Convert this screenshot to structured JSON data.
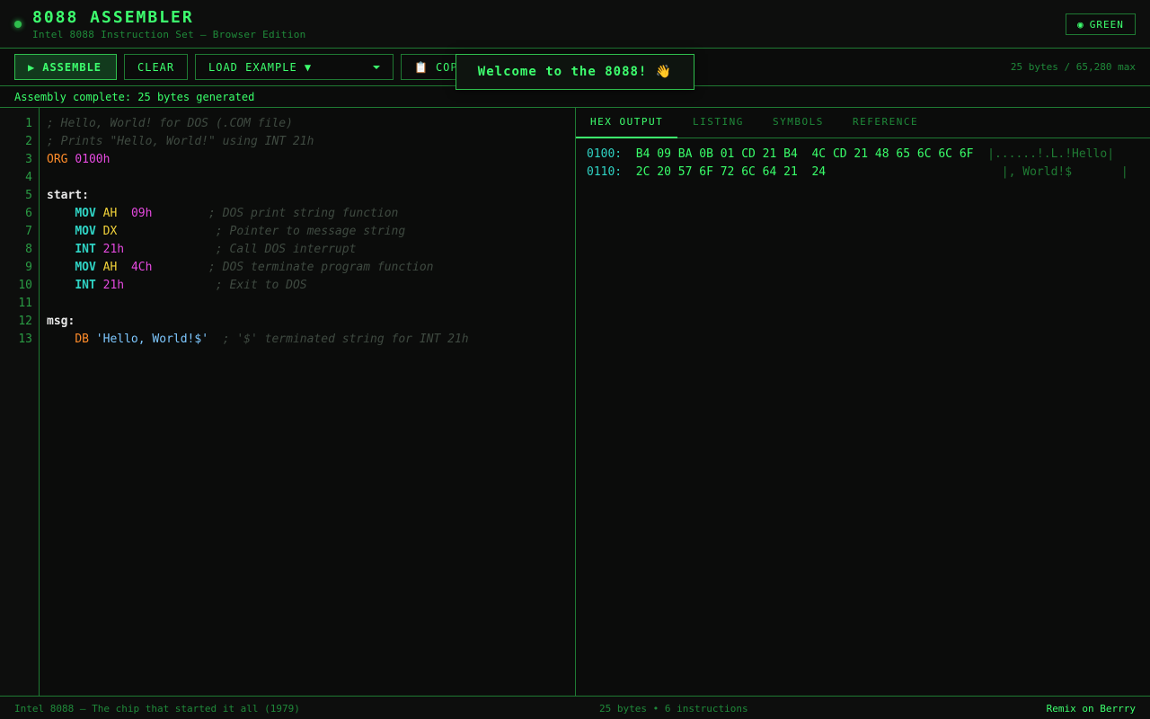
{
  "header": {
    "title": "8088 ASSEMBLER",
    "subtitle": "Intel 8088 Instruction Set — Browser Edition",
    "theme_icon": "◉",
    "theme_label": "GREEN"
  },
  "toolbar": {
    "assemble_icon": "▶",
    "assemble_label": "ASSEMBLE",
    "clear_label": "CLEAR",
    "load_example_label": "LOAD EXAMPLE ▼",
    "copy_icon": "📋",
    "copy_label": "COP",
    "bytes_info": "25 bytes / 65,280 max"
  },
  "status": {
    "message": "Assembly complete: 25 bytes generated"
  },
  "toast": {
    "message": "Welcome to the 8088! 👋"
  },
  "editor": {
    "line_numbers": [
      "1",
      "2",
      "3",
      "4",
      "5",
      "6",
      "7",
      "8",
      "9",
      "10",
      "11",
      "12",
      "13"
    ],
    "lines": [
      [
        {
          "t": "; Hello, World! for DOS (.COM file)",
          "c": "cmt"
        }
      ],
      [
        {
          "t": "; Prints \"Hello, World!\" using INT 21h",
          "c": "cmt"
        }
      ],
      [
        {
          "t": "ORG",
          "c": "dir"
        },
        {
          "t": " ",
          "c": ""
        },
        {
          "t": "0100h",
          "c": "num"
        }
      ],
      [],
      [
        {
          "t": "start:",
          "c": "lbl"
        }
      ],
      [
        {
          "t": "    ",
          "c": ""
        },
        {
          "t": "MOV",
          "c": "kw"
        },
        {
          "t": " ",
          "c": ""
        },
        {
          "t": "AH",
          "c": "reg"
        },
        {
          "t": "  ",
          "c": ""
        },
        {
          "t": "09h",
          "c": "num"
        },
        {
          "t": "        ",
          "c": ""
        },
        {
          "t": "; DOS print string function",
          "c": "cmt"
        }
      ],
      [
        {
          "t": "    ",
          "c": ""
        },
        {
          "t": "MOV",
          "c": "kw"
        },
        {
          "t": " ",
          "c": ""
        },
        {
          "t": "DX",
          "c": "reg"
        },
        {
          "t": "              ",
          "c": ""
        },
        {
          "t": "; Pointer to message string",
          "c": "cmt"
        }
      ],
      [
        {
          "t": "    ",
          "c": ""
        },
        {
          "t": "INT",
          "c": "kw"
        },
        {
          "t": " ",
          "c": ""
        },
        {
          "t": "21h",
          "c": "num"
        },
        {
          "t": "             ",
          "c": ""
        },
        {
          "t": "; Call DOS interrupt",
          "c": "cmt"
        }
      ],
      [
        {
          "t": "    ",
          "c": ""
        },
        {
          "t": "MOV",
          "c": "kw"
        },
        {
          "t": " ",
          "c": ""
        },
        {
          "t": "AH",
          "c": "reg"
        },
        {
          "t": "  ",
          "c": ""
        },
        {
          "t": "4Ch",
          "c": "num"
        },
        {
          "t": "        ",
          "c": ""
        },
        {
          "t": "; DOS terminate program function",
          "c": "cmt"
        }
      ],
      [
        {
          "t": "    ",
          "c": ""
        },
        {
          "t": "INT",
          "c": "kw"
        },
        {
          "t": " ",
          "c": ""
        },
        {
          "t": "21h",
          "c": "num"
        },
        {
          "t": "             ",
          "c": ""
        },
        {
          "t": "; Exit to DOS",
          "c": "cmt"
        }
      ],
      [],
      [
        {
          "t": "msg:",
          "c": "lbl"
        }
      ],
      [
        {
          "t": "    ",
          "c": ""
        },
        {
          "t": "DB",
          "c": "dir"
        },
        {
          "t": " ",
          "c": ""
        },
        {
          "t": "'Hello, World!$'",
          "c": "str"
        },
        {
          "t": "  ",
          "c": ""
        },
        {
          "t": "; '$' terminated string for INT 21h",
          "c": "cmt"
        }
      ]
    ]
  },
  "tabs": [
    {
      "label": "HEX OUTPUT",
      "active": true
    },
    {
      "label": "LISTING",
      "active": false
    },
    {
      "label": "SYMBOLS",
      "active": false
    },
    {
      "label": "REFERENCE",
      "active": false
    }
  ],
  "hex_output": [
    {
      "addr": "0100:",
      "bytes": "B4 09 BA 0B 01 CD 21 B4  4C CD 21 48 65 6C 6C 6F",
      "ascii": "|......!.L.!Hello|"
    },
    {
      "addr": "0110:",
      "bytes": "2C 20 57 6F 72 6C 64 21  24",
      "ascii": "|, World!$       |"
    }
  ],
  "footer": {
    "left": "Intel 8088 — The chip that started it all (1979)",
    "center": "25 bytes • 6 instructions",
    "right": "Remix on Berrry"
  },
  "colors": {
    "accent": "#3dff6e",
    "border": "#1f7a33",
    "background": "#0b0c0b",
    "keyword": "#2fd3c4",
    "directive": "#ff8c2a",
    "number": "#e64ae0",
    "register": "#f2d33a",
    "string": "#7ec8ff"
  }
}
